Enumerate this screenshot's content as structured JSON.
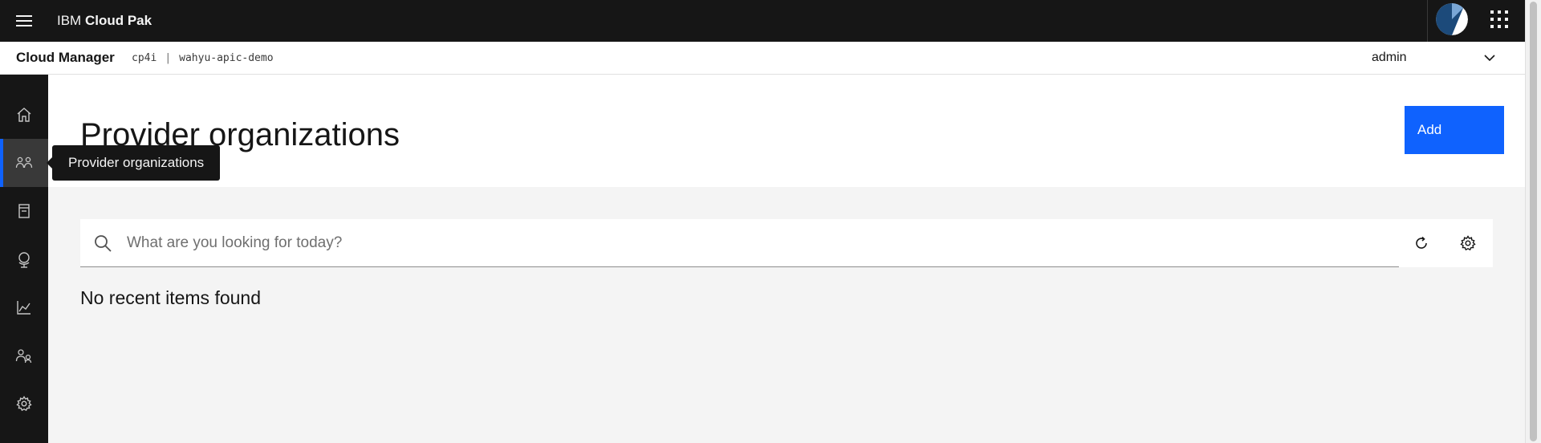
{
  "header": {
    "brand_prefix": "IBM",
    "brand_name": "Cloud Pak"
  },
  "subheader": {
    "app_name": "Cloud Manager",
    "context_1": "cp4i",
    "context_separator": "|",
    "context_2": "wahyu-apic-demo",
    "user": "admin"
  },
  "sidenav": {
    "items": [
      {
        "icon": "home-icon"
      },
      {
        "icon": "user-group-icon",
        "active": true
      },
      {
        "icon": "catalog-icon"
      },
      {
        "icon": "globe-icon"
      },
      {
        "icon": "analytics-icon"
      },
      {
        "icon": "user-admin-icon"
      },
      {
        "icon": "settings-icon"
      }
    ]
  },
  "tooltip": {
    "text": "Provider organizations"
  },
  "page": {
    "title": "Provider organizations",
    "add_label": "Add",
    "search_placeholder": "What are you looking for today?",
    "empty_message": "No recent items found"
  },
  "colors": {
    "header_bg": "#161616",
    "accent": "#0f62fe",
    "page_bg": "#f4f4f4"
  }
}
